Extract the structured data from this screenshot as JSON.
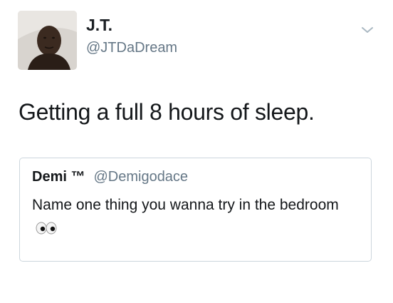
{
  "tweet": {
    "author": {
      "display_name": "J.T.",
      "handle": "@JTDaDream",
      "avatar_icon": "profile-photo"
    },
    "menu_icon": "chevron-down-icon",
    "text": "Getting a full 8 hours of sleep.",
    "quoted_tweet": {
      "display_name": "Demi ™",
      "handle": "@Demigodace",
      "text": "Name one thing you wanna try in the bedroom",
      "emoji": "eyes-emoji"
    }
  },
  "colors": {
    "text": "#14171a",
    "secondary_text": "#657786",
    "border": "#ccd6dd"
  }
}
